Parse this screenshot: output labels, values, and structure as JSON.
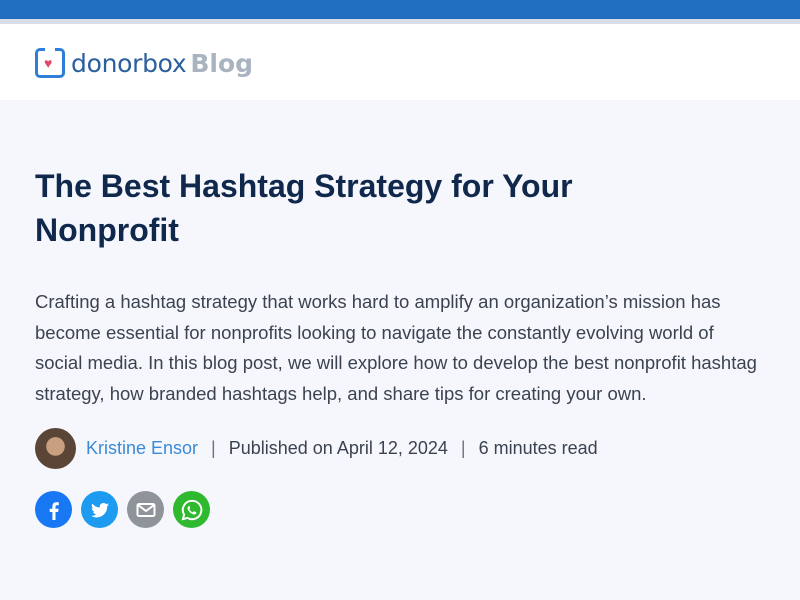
{
  "brand": {
    "name": "donorbox",
    "section": "Blog"
  },
  "article": {
    "title": "The Best Hashtag Strategy for Your Nonprofit",
    "intro": "Crafting a hashtag strategy that works hard to amplify an organization’s mission has become essential for nonprofits looking to navigate the constantly evolving world of social media. In this blog post, we will explore how to develop the best nonprofit hashtag strategy, how branded hashtags help, and share tips for creating your own.",
    "author": "Kristine Ensor",
    "separator": "|",
    "published": "Published on April 12, 2024",
    "read_time": "6 minutes read"
  },
  "share": [
    "facebook-icon",
    "twitter-icon",
    "email-icon",
    "whatsapp-icon"
  ],
  "colors": {
    "topbar": "#1f6ebf",
    "title": "#10284b",
    "author_link": "#3a8ad6",
    "background": "#f5f7fd"
  }
}
